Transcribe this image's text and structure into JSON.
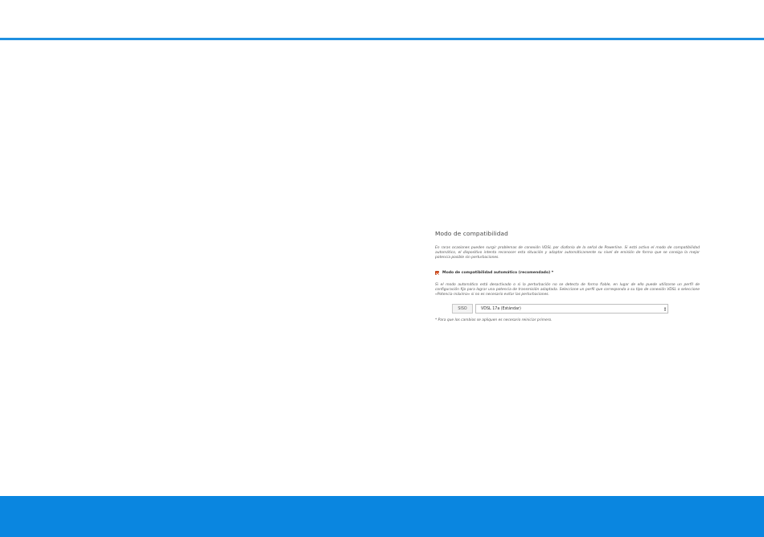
{
  "colors": {
    "accent": "#1f8fe0",
    "footer_band": "#0a86e0",
    "checkbox": "#e0592a"
  },
  "section": {
    "title": "Modo de compatibilidad",
    "intro": "En raras ocasiones pueden surgir problemas de conexión VDSL por diafonía de la señal de Powerline. Si está activo el modo de compatibilidad automático, el dispositivo intenta reconocer esta situación y adaptar automáticamente su nivel de emisión de forma que se consiga la mejor potencia posible sin perturbaciones.",
    "checkbox": {
      "label": "Modo de compatibilidad automático (recomendado) *",
      "checked": true
    },
    "detail": "Si el modo automático está desactivado o si la perturbación no se detecta de forma fiable, en lugar de ello puede utilizarse un perfil de configuración fijo para lograr una potencia de transmisión adaptada. Seleccione un perfil que corresponda a su tipo de conexión VDSL o seleccione «Potencia máxima» si no es necesario evitar las perturbaciones.",
    "profile": {
      "tag": "SISO",
      "selected": "VDSL 17a (Estándar)"
    },
    "footnote": "* Para que los cambios se apliquen es necesario reiniciar primero."
  }
}
